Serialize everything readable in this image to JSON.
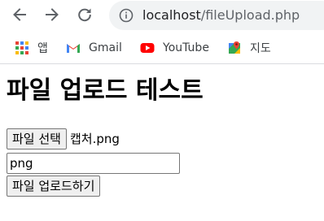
{
  "browser": {
    "url_host": "localhost",
    "url_path": "/fileUpload.php",
    "bookmarks": [
      {
        "label": "앱",
        "icon": "apps-grid-icon"
      },
      {
        "label": "Gmail",
        "icon": "gmail-icon"
      },
      {
        "label": "YouTube",
        "icon": "youtube-icon"
      },
      {
        "label": "지도",
        "icon": "maps-icon"
      }
    ]
  },
  "page": {
    "title": "파일 업로드 테스트",
    "file_button_label": "파일 선택",
    "selected_file_name": "캡처.png",
    "text_input_value": "png",
    "submit_label": "파일 업로드하기"
  }
}
